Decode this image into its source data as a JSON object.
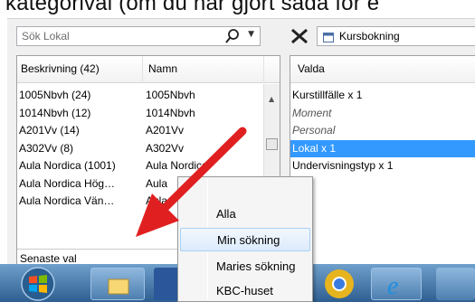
{
  "instruction_text": "kategorival (om du har gjort sådä för e",
  "search": {
    "placeholder": "Sök Lokal"
  },
  "grid": {
    "col_beskrivning": "Beskrivning (42)",
    "col_namn": "Namn",
    "rows": [
      {
        "desc": "1005Nbvh (24)",
        "name": "1005Nbvh"
      },
      {
        "desc": "1014Nbvh (12)",
        "name": "1014Nbvh"
      },
      {
        "desc": "A201Vv (14)",
        "name": "A201Vv"
      },
      {
        "desc": "A302Vv (8)",
        "name": "A302Vv"
      },
      {
        "desc": "Aula Nordica (1001)",
        "name": "Aula Nordica"
      },
      {
        "desc": "Aula Nordica Hög…",
        "name": "Aula"
      },
      {
        "desc": "Aula Nordica Vän…",
        "name": "Aula"
      }
    ],
    "recent_label": "Senaste val"
  },
  "combo": {
    "value": "Kursbokning"
  },
  "selected": {
    "header": "Valda",
    "items": [
      {
        "label": "Kurstillfälle x 1",
        "style": "normal"
      },
      {
        "label": "Moment",
        "style": "italic"
      },
      {
        "label": "Personal",
        "style": "italic"
      },
      {
        "label": "Lokal x 1",
        "style": "active"
      },
      {
        "label": "Undervisningstyp x 1",
        "style": "normal"
      }
    ]
  },
  "menu": {
    "items": [
      "Alla",
      "Min sökning",
      "Maries sökning",
      "KBC-huset"
    ],
    "hovered_index": 1
  },
  "colors": {
    "selection": "#3399ff",
    "arrow": "#e02020",
    "taskbar": "#2f5f91"
  }
}
